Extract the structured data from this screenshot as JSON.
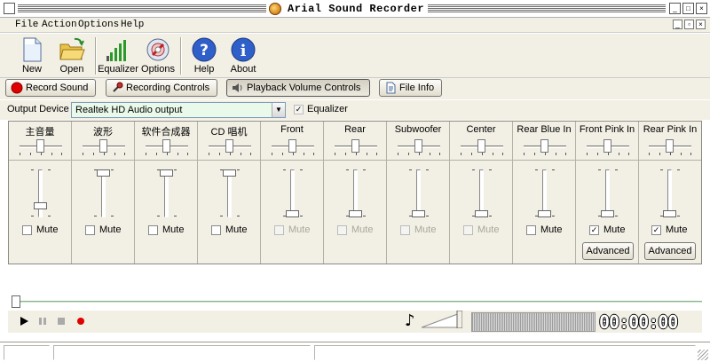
{
  "window": {
    "title": "Arial Sound Recorder"
  },
  "menu": [
    "File",
    "Action",
    "Options",
    "Help"
  ],
  "toolbar": [
    {
      "label": "New",
      "icon": "new-file-icon"
    },
    {
      "label": "Open",
      "icon": "open-folder-icon"
    },
    {
      "label": "Equalizer",
      "icon": "equalizer-icon"
    },
    {
      "label": "Options",
      "icon": "options-icon"
    },
    {
      "label": "Help",
      "icon": "help-icon"
    },
    {
      "label": "About",
      "icon": "about-icon"
    }
  ],
  "tabs": [
    {
      "label": "Record Sound",
      "active": false
    },
    {
      "label": "Recording Controls",
      "active": false
    },
    {
      "label": "Playback Volume Controls",
      "active": true
    },
    {
      "label": "File Info",
      "active": false
    }
  ],
  "device": {
    "label": "Output Device",
    "value": "Realtek HD Audio output",
    "equalizer_label": "Equalizer",
    "equalizer_checked": true
  },
  "mute_label": "Mute",
  "advanced_label": "Advanced",
  "channels": [
    {
      "name": "主音量",
      "level": 0.2,
      "mute_enabled": true,
      "muted": false,
      "advanced": false
    },
    {
      "name": "波形",
      "level": 1.0,
      "mute_enabled": true,
      "muted": false,
      "advanced": false
    },
    {
      "name": "软件合成器",
      "level": 1.0,
      "mute_enabled": true,
      "muted": false,
      "advanced": false
    },
    {
      "name": "CD 唱机",
      "level": 1.0,
      "mute_enabled": true,
      "muted": false,
      "advanced": false
    },
    {
      "name": "Front",
      "level": 0.0,
      "mute_enabled": false,
      "muted": false,
      "advanced": false
    },
    {
      "name": "Rear",
      "level": 0.0,
      "mute_enabled": false,
      "muted": false,
      "advanced": false
    },
    {
      "name": "Subwoofer",
      "level": 0.0,
      "mute_enabled": false,
      "muted": false,
      "advanced": false
    },
    {
      "name": "Center",
      "level": 0.0,
      "mute_enabled": false,
      "muted": false,
      "advanced": false
    },
    {
      "name": "Rear Blue In",
      "level": 0.0,
      "mute_enabled": true,
      "muted": false,
      "advanced": false
    },
    {
      "name": "Front Pink In",
      "level": 0.0,
      "mute_enabled": true,
      "muted": true,
      "advanced": true
    },
    {
      "name": "Rear Pink In",
      "level": 0.0,
      "mute_enabled": true,
      "muted": true,
      "advanced": true
    }
  ],
  "transport": {
    "time": "00:00:00",
    "playback_volume": 1.0
  },
  "colors": {
    "face": "#f2efe4",
    "record_red": "#e00000",
    "device_field": "#eafaea"
  }
}
